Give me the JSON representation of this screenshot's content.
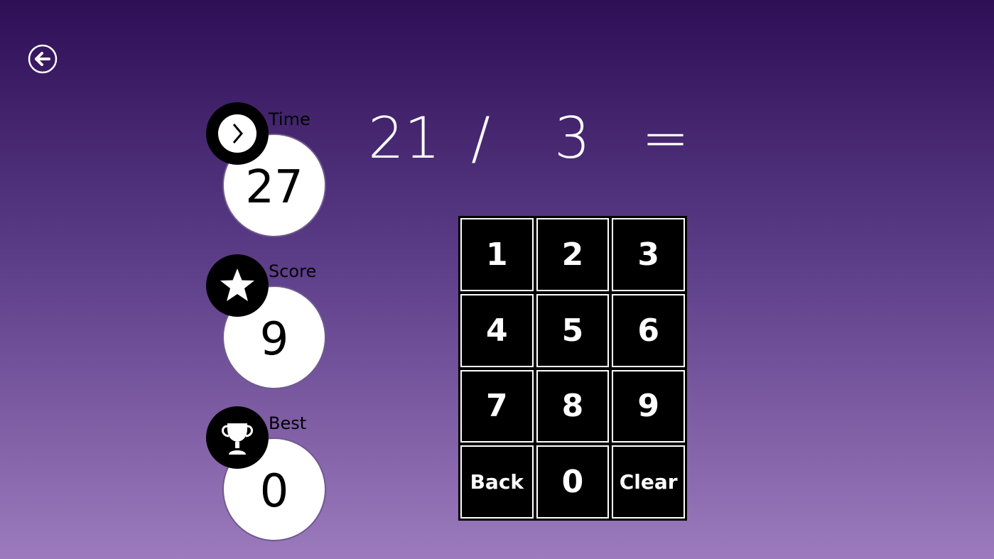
{
  "header": {
    "back_icon": "arrow-left-circle-icon"
  },
  "stats": {
    "time": {
      "label": "Time",
      "value": "27",
      "icon": "chevron-right-clock-icon"
    },
    "score": {
      "label": "Score",
      "value": "9",
      "icon": "star-icon"
    },
    "best": {
      "label": "Best",
      "value": "0",
      "icon": "trophy-icon"
    }
  },
  "equation": {
    "left": "21",
    "operator": "/",
    "right": "3",
    "equals": "="
  },
  "keypad": {
    "k1": "1",
    "k2": "2",
    "k3": "3",
    "k4": "4",
    "k5": "5",
    "k6": "6",
    "k7": "7",
    "k8": "8",
    "k9": "9",
    "back": "Back",
    "k0": "0",
    "clear": "Clear"
  },
  "colors": {
    "bg_top": "#2e0f56",
    "bg_bottom": "#9c7abd",
    "key_bg": "#000000",
    "key_text": "#ffffff"
  }
}
